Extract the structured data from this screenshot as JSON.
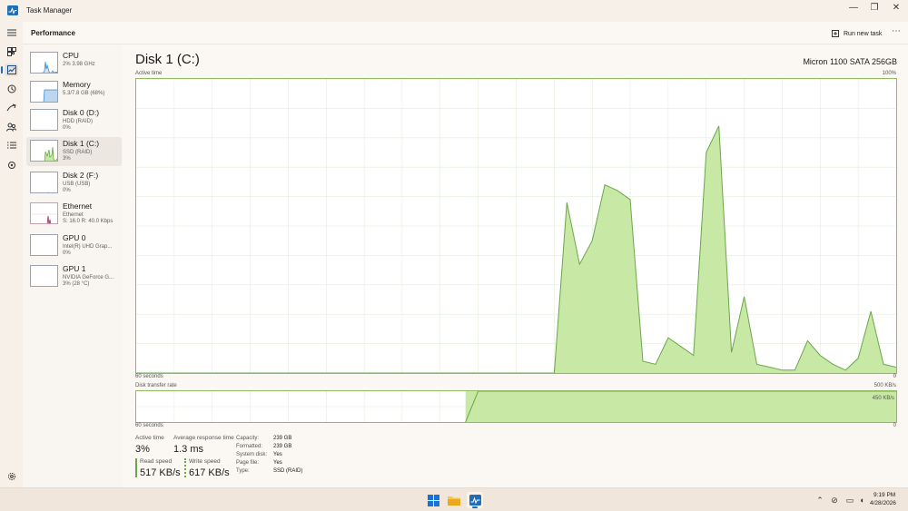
{
  "window": {
    "title": "Task Manager",
    "minimize_glyph": "—",
    "maximize_glyph": "❐",
    "close_glyph": "✕"
  },
  "nav": {
    "items": [
      "hamburger-menu",
      "processes",
      "performance",
      "app-history",
      "startup-apps",
      "users",
      "details",
      "services"
    ],
    "active": "performance",
    "settings": "settings"
  },
  "header": {
    "section_title": "Performance",
    "run_new_task": "Run new task",
    "more_glyph": "⋯"
  },
  "sidebar": {
    "items": [
      {
        "name": "CPU",
        "sub1": "2% 3.98 GHz",
        "sub2": ""
      },
      {
        "name": "Memory",
        "sub1": "5.3/7.8 GB (68%)",
        "sub2": ""
      },
      {
        "name": "Disk 0 (D:)",
        "sub1": "HDD (RAID)",
        "sub2": "0%"
      },
      {
        "name": "Disk 1 (C:)",
        "sub1": "SSD (RAID)",
        "sub2": "3%"
      },
      {
        "name": "Disk 2 (F:)",
        "sub1": "USB (USB)",
        "sub2": "0%"
      },
      {
        "name": "Ethernet",
        "sub1": "Ethernet",
        "sub2": "S: 16.0 R: 40.0 Kbps"
      },
      {
        "name": "GPU 0",
        "sub1": "Intel(R) UHD Grap...",
        "sub2": "0%"
      },
      {
        "name": "GPU 1",
        "sub1": "NVIDIA GeForce G...",
        "sub2": "3% (28 °C)"
      }
    ],
    "selected_index": 3
  },
  "detail": {
    "title": "Disk 1 (C:)",
    "model": "Micron 1100 SATA 256GB",
    "active_chart": {
      "label": "Active time",
      "max_label": "100%",
      "time_label": "60 seconds",
      "min_label": "0"
    },
    "transfer_chart": {
      "label": "Disk transfer rate",
      "max_label": "500 KB/s",
      "inner_label": "450 KB/s",
      "time_label": "60 seconds",
      "min_label": "0"
    },
    "stats": {
      "active_time_label": "Active time",
      "active_time_value": "3%",
      "avg_response_label": "Average response time",
      "avg_response_value": "1.3 ms",
      "read_speed_label": "Read speed",
      "read_speed_value": "517 KB/s",
      "write_speed_label": "Write speed",
      "write_speed_value": "617 KB/s"
    },
    "info": [
      {
        "key": "Capacity:",
        "value": "239 GB"
      },
      {
        "key": "Formatted:",
        "value": "239 GB"
      },
      {
        "key": "System disk:",
        "value": "Yes"
      },
      {
        "key": "Page file:",
        "value": "Yes"
      },
      {
        "key": "Type:",
        "value": "SSD (RAID)"
      }
    ]
  },
  "chart_data": {
    "type": "area",
    "title": "Active time",
    "x": [
      60,
      59,
      58,
      57,
      56,
      55,
      54,
      53,
      52,
      51,
      50,
      49,
      48,
      47,
      46,
      45,
      44,
      43,
      42,
      41,
      40,
      39,
      38,
      37,
      36,
      35,
      34,
      33,
      32,
      31,
      30,
      29,
      28,
      27,
      26,
      25,
      24,
      23,
      22,
      21,
      20,
      19,
      18,
      17,
      16,
      15,
      14,
      13,
      12,
      11,
      10,
      9,
      8,
      7,
      6,
      5,
      4,
      3,
      2,
      1,
      0
    ],
    "xlim": [
      60,
      0
    ],
    "ylim": [
      0,
      100
    ],
    "values": [
      0,
      0,
      0,
      0,
      0,
      0,
      0,
      0,
      0,
      0,
      0,
      0,
      0,
      0,
      0,
      0,
      0,
      0,
      0,
      0,
      0,
      0,
      0,
      0,
      0,
      0,
      0,
      0,
      0,
      0,
      0,
      0,
      0,
      0,
      58,
      37,
      45,
      64,
      62,
      59,
      4,
      3,
      12,
      9,
      6,
      75,
      84,
      7,
      26,
      3,
      2,
      1,
      1,
      11,
      6,
      3,
      1,
      5,
      21,
      3,
      2,
      2
    ],
    "colors": {
      "fill": "#c8e8a5",
      "stroke": "#6aa74a",
      "grid": "#e3eddb"
    }
  },
  "transfer_data": {
    "x": [
      34,
      33,
      32,
      31,
      30,
      29,
      28,
      27,
      26,
      25,
      24,
      23,
      22,
      21,
      20,
      19,
      18,
      17,
      16,
      15,
      14,
      13,
      12,
      11,
      10,
      9,
      8,
      7,
      6,
      5,
      4,
      3,
      2,
      1,
      0
    ],
    "read_kbs": [
      500,
      500,
      500,
      500,
      500,
      500,
      500,
      500,
      500,
      500,
      500,
      500,
      500,
      500,
      500,
      500,
      500,
      500,
      500,
      500,
      500,
      500,
      500,
      500,
      500,
      500,
      500,
      500,
      500,
      500,
      500,
      500,
      500,
      500,
      500
    ],
    "write_kbs": [
      0,
      500,
      500,
      500,
      500,
      500,
      500,
      500,
      500,
      500,
      500,
      500,
      500,
      500,
      500,
      500,
      500,
      500,
      500,
      500,
      500,
      500,
      500,
      500,
      500,
      500,
      500,
      500,
      500,
      500,
      500,
      500,
      500,
      500,
      500
    ]
  },
  "taskbar": {
    "apps": [
      "windows-start",
      "file-explorer",
      "task-manager"
    ],
    "time": "9:19 PM",
    "date": "4/28/2026"
  }
}
